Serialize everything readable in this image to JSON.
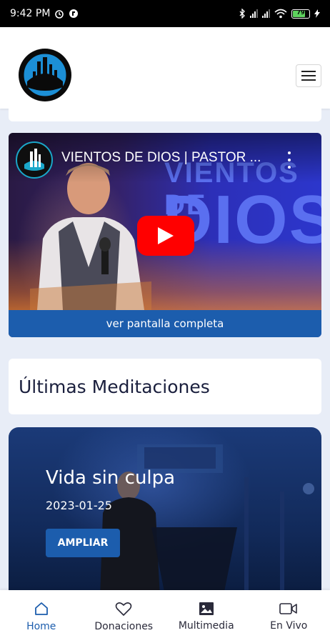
{
  "status_bar": {
    "time": "9:42 PM",
    "battery": "79"
  },
  "colors": {
    "primary": "#1c5dad",
    "youtube_red": "#ff0000",
    "text_dark": "#1a1f3d"
  },
  "header": {
    "logo_icon": "church-logo-icon",
    "menu_icon": "hamburger-menu-icon"
  },
  "video": {
    "title": "VIENTOS DE DIOS | PASTOR ...",
    "thumbnail_text_1": "VIENTOS DE",
    "thumbnail_text_2": "DIOS",
    "fullscreen_label": "ver pantalla completa"
  },
  "section": {
    "title": "Últimas Meditaciones"
  },
  "meditation": {
    "title": "Vida sin culpa",
    "date": "2023-01-25",
    "button_label": "AMPLIAR"
  },
  "bottom_nav": {
    "items": [
      {
        "label": "Home",
        "icon": "home-icon",
        "active": true
      },
      {
        "label": "Donaciones",
        "icon": "heart-icon",
        "active": false
      },
      {
        "label": "Multimedia",
        "icon": "image-icon",
        "active": false
      },
      {
        "label": "En Vivo",
        "icon": "video-camera-icon",
        "active": false
      }
    ]
  }
}
